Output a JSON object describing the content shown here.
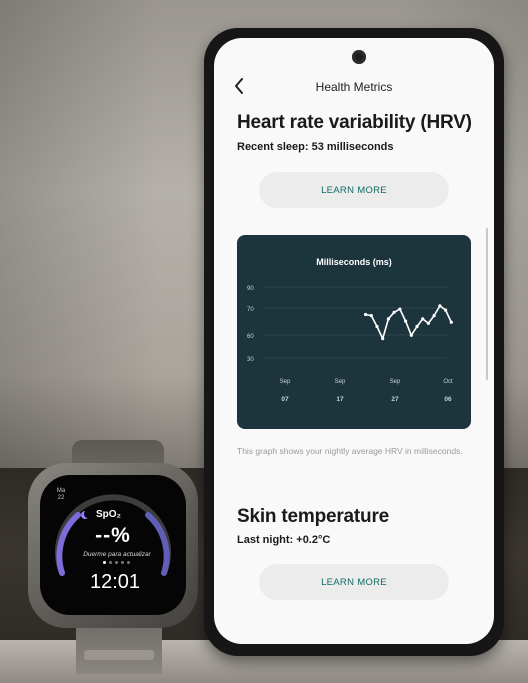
{
  "header": {
    "title": "Health Metrics"
  },
  "hrv": {
    "title": "Heart rate variability (HRV)",
    "subtitle": "Recent sleep: 53 milliseconds",
    "button_label": "LEARN MORE",
    "description": "This graph shows your nightly average HRV in milliseconds."
  },
  "chart_data": {
    "type": "line",
    "title": "Milliseconds (ms)",
    "y_ticks": [
      "90",
      "70",
      "60",
      "30"
    ],
    "x_ticks": [
      {
        "month": "Sep",
        "day": "07"
      },
      {
        "month": "Sep",
        "day": "17"
      },
      {
        "month": "Sep",
        "day": "27"
      },
      {
        "month": "Oct",
        "day": "06"
      }
    ],
    "ylim": [
      20,
      95
    ],
    "x_range": [
      "2023-09-02",
      "2023-10-07"
    ],
    "series": [
      {
        "points": [
          {
            "x": "2023-09-21",
            "y": 68
          },
          {
            "x": "2023-09-22",
            "y": 67
          },
          {
            "x": "2023-09-23",
            "y": 57
          },
          {
            "x": "2023-09-24",
            "y": 46
          },
          {
            "x": "2023-09-25",
            "y": 64
          },
          {
            "x": "2023-09-26",
            "y": 70
          },
          {
            "x": "2023-09-27",
            "y": 73
          },
          {
            "x": "2023-09-28",
            "y": 62
          },
          {
            "x": "2023-09-29",
            "y": 49
          },
          {
            "x": "2023-09-30",
            "y": 57
          },
          {
            "x": "2023-10-01",
            "y": 64
          },
          {
            "x": "2023-10-02",
            "y": 60
          },
          {
            "x": "2023-10-03",
            "y": 67
          },
          {
            "x": "2023-10-04",
            "y": 76
          },
          {
            "x": "2023-10-05",
            "y": 72
          },
          {
            "x": "2023-10-06",
            "y": 61
          }
        ]
      }
    ],
    "grid": true,
    "colors": {
      "background": "#1c343c",
      "line": "#ffffff",
      "grid": "#3b555d",
      "tick": "#c7d3d6"
    }
  },
  "skin": {
    "title": "Skin temperature",
    "subtitle": "Last night: +0.2°C",
    "button_label": "LEARN MORE"
  },
  "watch": {
    "date_day": "Ma",
    "date_num": "22",
    "metric": "SpO₂",
    "value": "--%",
    "hint": "Duerme para actualizar",
    "time": "12:01"
  }
}
